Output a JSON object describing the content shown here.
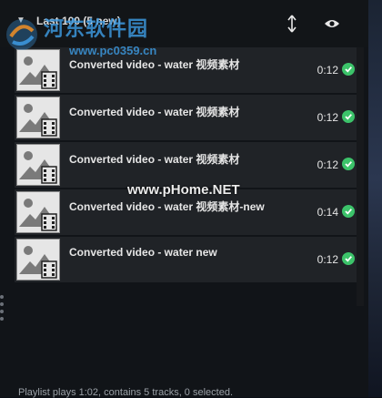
{
  "header": {
    "title": "Last 100 (5 new)",
    "collapse_icon": "triangle-down-icon",
    "sort_icon": "sort-arrows-icon",
    "visibility_icon": "eye-icon"
  },
  "tracks": [
    {
      "title": "Converted video - water 视频素材",
      "duration": "0:12",
      "status_icon": "check-circle-icon"
    },
    {
      "title": "Converted video - water 视频素材",
      "duration": "0:12",
      "status_icon": "check-circle-icon"
    },
    {
      "title": "Converted video - water 视频素材",
      "duration": "0:12",
      "status_icon": "check-circle-icon"
    },
    {
      "title": "Converted video - water 视频素材-new",
      "duration": "0:14",
      "status_icon": "check-circle-icon"
    },
    {
      "title": "Converted video - water  new",
      "duration": "0:12",
      "status_icon": "check-circle-icon"
    }
  ],
  "status_bar": {
    "text": "Playlist plays  1:02, contains 5 tracks, 0 selected."
  },
  "watermarks": {
    "top_name": "河东软件园",
    "top_url": "www.pc0359.cn",
    "center": "www.pHome.NET"
  },
  "colors": {
    "panel_bg": "#111418",
    "row_bg": "#202327",
    "check_green": "#3cc36a",
    "watermark_blue": "#3c96dc"
  }
}
